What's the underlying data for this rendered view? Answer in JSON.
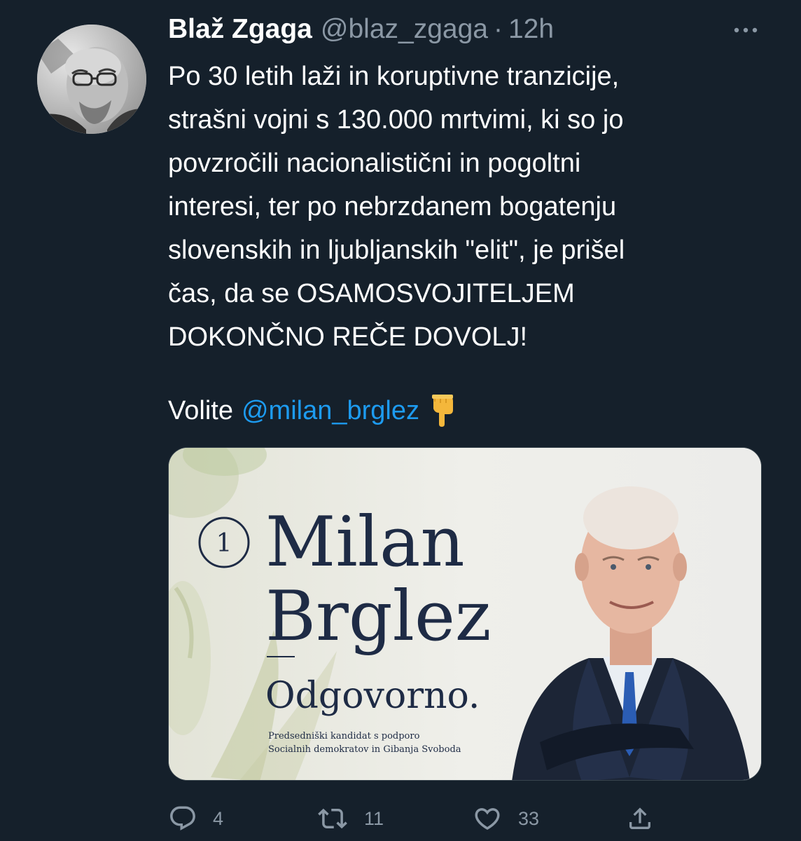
{
  "tweet": {
    "author": {
      "name": "Blaž Zgaga",
      "handle": "@blaz_zgaga",
      "separator": "·",
      "time": "12h"
    },
    "text_lines": [
      "Po 30 letih laži in koruptivne tranzicije,",
      "strašni vojni s 130.000 mrtvimi, ki so jo",
      "povzročili nacionalistični in pogoltni",
      "interesi, ter po nebrzdanem bogatenju",
      "slovenskih in ljubljanskih \"elit\", je prišel",
      "čas, da se OSAMOSVOJITELJEM",
      "DOKONČNO REČE DOVOLJ!"
    ],
    "vote_prefix": "Volite",
    "mention": "@milan_brglez",
    "emoji": "pointing-down-emoji",
    "media": {
      "number": "1",
      "first_name": "Milan",
      "last_name": "Brglez",
      "slogan": "Odgovorno.",
      "caption_lines": [
        "Predsedniški kandidat s podporo",
        "Socialnih demokratov in Gibanja Svoboda"
      ]
    },
    "actions": {
      "replies": "4",
      "retweets": "11",
      "likes": "33"
    }
  },
  "colors": {
    "background": "#15202b",
    "text": "#ffffff",
    "secondary": "#8b98a5",
    "link": "#1d9bf0",
    "media_text": "#1e2b45"
  },
  "icons": {
    "more": "more-dots-icon",
    "reply": "reply-bubble-icon",
    "retweet": "retweet-icon",
    "like": "heart-icon",
    "share": "share-upload-icon"
  }
}
